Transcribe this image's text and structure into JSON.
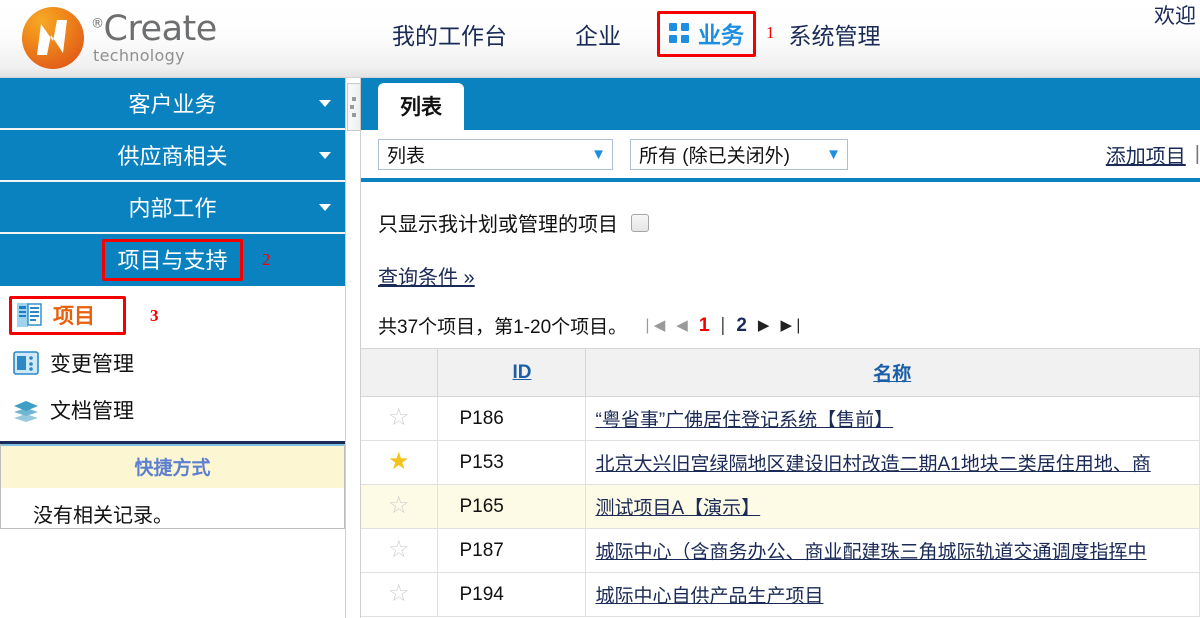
{
  "brand": {
    "name": "Create",
    "sub": "technology",
    "reg": "®",
    "logo_color": "#e4651a"
  },
  "header": {
    "welcome": "欢迎",
    "nav": [
      {
        "label": "我的工作台",
        "icon": "",
        "active": false
      },
      {
        "label": "企业",
        "icon": "",
        "active": false
      },
      {
        "label": "业务",
        "icon": "grid-icon",
        "active": true,
        "annotation": "1"
      },
      {
        "label": "系统管理",
        "icon": "",
        "active": false
      }
    ]
  },
  "sidebar": {
    "groups": [
      {
        "label": "客户业务",
        "expanded": false
      },
      {
        "label": "供应商相关",
        "expanded": false
      },
      {
        "label": "内部工作",
        "expanded": false
      },
      {
        "label": "项目与支持",
        "expanded": true,
        "annotation": "2"
      }
    ],
    "links": [
      {
        "label": "项目",
        "icon": "project-icon",
        "current": true,
        "annotation": "3"
      },
      {
        "label": "变更管理",
        "icon": "change-management-icon",
        "current": false
      },
      {
        "label": "文档管理",
        "icon": "document-management-icon",
        "current": false
      }
    ],
    "shortcuts": {
      "title": "快捷方式",
      "empty": "没有相关记录。"
    }
  },
  "main": {
    "tabs": [
      {
        "label": "列表",
        "active": true
      }
    ],
    "toolbar": {
      "view_select": {
        "value": "列表",
        "options": [
          "列表"
        ]
      },
      "status_select": {
        "value": "所有 (除已关闭外)",
        "options": [
          "所有 (除已关闭外)"
        ]
      },
      "add_link": "添加项目",
      "separator": "|"
    },
    "filter": {
      "checkbox_label": "只显示我计划或管理的项目",
      "checked": false,
      "query_link": "查询条件 »"
    },
    "pagination": {
      "summary": "共37个项目，第1-20个项目。",
      "first_icon": "❘◀",
      "prev_icon": "◀",
      "next_icon": "▶",
      "last_icon": "▶❘",
      "pages": [
        "1",
        "2"
      ],
      "current_page": "1",
      "page_separator": "|"
    },
    "table": {
      "columns": [
        {
          "key": "star",
          "label": ""
        },
        {
          "key": "id",
          "label": "ID"
        },
        {
          "key": "name",
          "label": "名称"
        }
      ],
      "rows": [
        {
          "star": false,
          "id": "P186",
          "name": "“粤省事”广佛居住登记系统【售前】",
          "alt": false
        },
        {
          "star": true,
          "id": "P153",
          "name": "北京大兴旧宫绿隔地区建设旧村改造二期A1地块二类居住用地、商",
          "alt": false
        },
        {
          "star": false,
          "id": "P165",
          "name": "测试项目A【演示】",
          "alt": true
        },
        {
          "star": false,
          "id": "P187",
          "name": "城际中心（含商务办公、商业配建珠三角城际轨道交通调度指挥中",
          "alt": false
        },
        {
          "star": false,
          "id": "P194",
          "name": "城际中心自供产品生产项目",
          "alt": false
        }
      ]
    }
  },
  "colors": {
    "primary_blue": "#0b82c0",
    "link_blue": "#1b2a56",
    "accent_orange": "#e8600b",
    "annotation_red": "#f40000",
    "star_gold": "#f4c21a",
    "alt_row": "#fdfae6"
  }
}
